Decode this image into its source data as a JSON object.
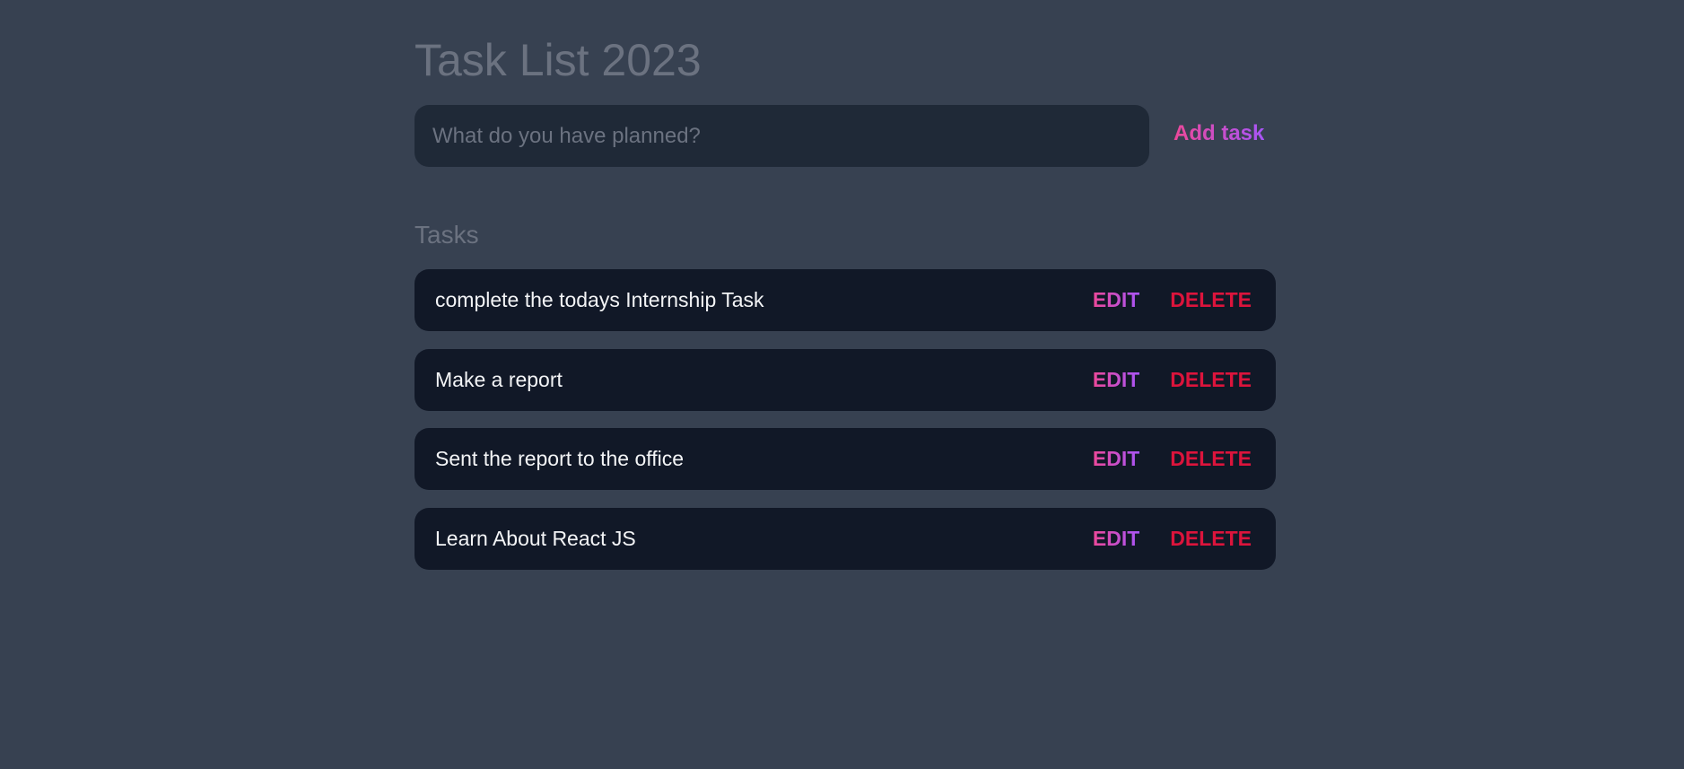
{
  "header": {
    "title": "Task List 2023"
  },
  "form": {
    "placeholder": "What do you have planned?",
    "value": "",
    "add_label": "Add task"
  },
  "tasks_heading": "Tasks",
  "tasks": [
    {
      "text": "complete the todays Internship Task",
      "edit_label": "EDIT",
      "delete_label": "DELETE"
    },
    {
      "text": "Make a report",
      "edit_label": "EDIT",
      "delete_label": "DELETE"
    },
    {
      "text": "Sent the report to the office",
      "edit_label": "EDIT",
      "delete_label": "DELETE"
    },
    {
      "text": "Learn About React JS",
      "edit_label": "EDIT",
      "delete_label": "DELETE"
    }
  ],
  "colors": {
    "background": "#374151",
    "input": "#1f2937",
    "row": "#111827",
    "accent_start": "#ec4899",
    "accent_end": "#a855f7",
    "delete": "#dc143c"
  }
}
